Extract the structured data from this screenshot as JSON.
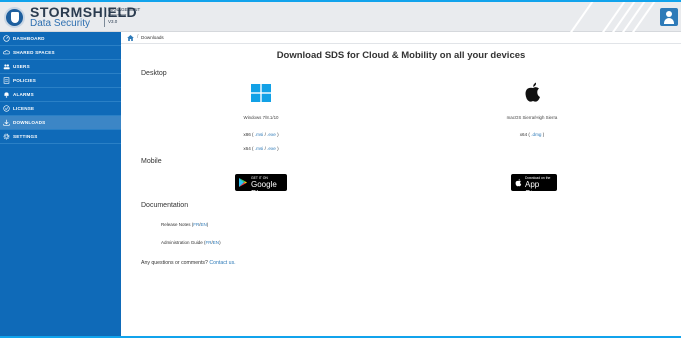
{
  "header": {
    "brand": "STORMSHIELD",
    "brand_sub": "Data Security",
    "product_line1": "MANAGEMENT",
    "product_line2": "CENTER",
    "product_line3": "V3.0"
  },
  "sidebar": {
    "items": [
      {
        "label": "DASHBOARD",
        "icon": "dashboard-icon"
      },
      {
        "label": "SHARED SPACES",
        "icon": "cloud-icon"
      },
      {
        "label": "USERS",
        "icon": "users-icon"
      },
      {
        "label": "POLICIES",
        "icon": "policy-icon"
      },
      {
        "label": "ALARMS",
        "icon": "bell-icon"
      },
      {
        "label": "LICENSE",
        "icon": "license-icon"
      },
      {
        "label": "DOWNLOADS",
        "icon": "download-icon"
      },
      {
        "label": "SETTINGS",
        "icon": "gear-icon"
      }
    ]
  },
  "breadcrumb": {
    "current": "Downloads"
  },
  "page": {
    "title": "Download SDS for Cloud & Mobility on all your devices",
    "desktop": {
      "heading": "Desktop",
      "windows": {
        "label": "Windows 7/8.1/10",
        "x86_prefix": "x86 (",
        "x86_msi": ".msi",
        "x86_sep": "/",
        "x86_exe": ".exe",
        "x86_suffix": ")",
        "x64_prefix": "x64 (",
        "x64_msi": ".msi",
        "x64_sep": "/",
        "x64_exe": ".exe",
        "x64_suffix": ")"
      },
      "mac": {
        "label": "macOS Sierra/High Sierra",
        "x64_prefix": "x64 (",
        "x64_dmg": ".dmg",
        "x64_suffix": ")"
      }
    },
    "mobile": {
      "heading": "Mobile",
      "google_top": "GET IT ON",
      "google_main": "Google Play",
      "apple_top": "Download on the",
      "apple_main": "App Store"
    },
    "documentation": {
      "heading": "Documentation",
      "release_label": "Release Notes (",
      "release_fr": "FR",
      "release_sep": "/",
      "release_en": "EN",
      "release_end": ")",
      "admin_label": "Administration Guide (",
      "admin_fr": "FR",
      "admin_sep": "/",
      "admin_en": "EN",
      "admin_end": ")"
    },
    "contact": {
      "text": "Any questions or comments?",
      "link": "Contact us."
    }
  },
  "colors": {
    "frame": "#11a3ec",
    "sidebar": "#0f6ab8",
    "sidebar_active": "#3c86c6",
    "link": "#2d7ab8",
    "windows": "#12a1e6"
  }
}
